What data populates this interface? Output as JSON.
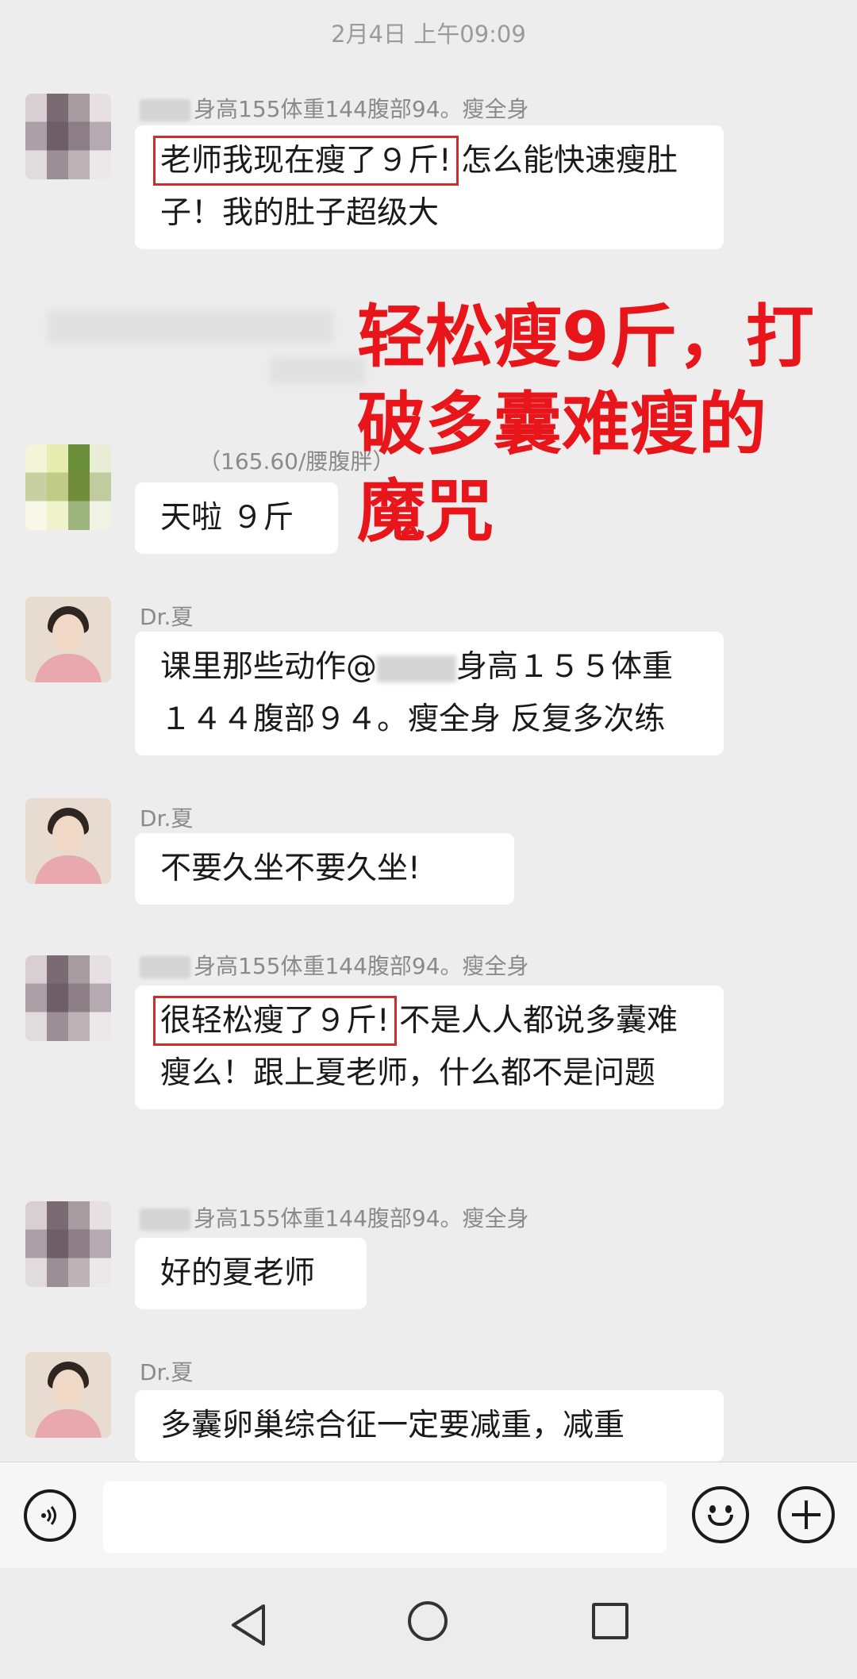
{
  "timestamp": "2月4日 上午09:09",
  "overlay_text": "轻松瘦9斤，打破多囊难瘦的魔咒",
  "messages": [
    {
      "sender": "身高155体重144腹部94。瘦全身",
      "highlight": "老师我现在瘦了９斤!",
      "text": "怎么能快速瘦肚子！我的肚子超级大"
    },
    {
      "sender": "（165.60/腰腹胖）",
      "text": "天啦 ９斤"
    },
    {
      "sender": "Dr.夏",
      "text_a": "课里那些动作@",
      "text_b": "身高１５５体重１４４腹部９４。瘦全身 反复多次练"
    },
    {
      "sender": "Dr.夏",
      "text": "不要久坐不要久坐!"
    },
    {
      "sender": "身高155体重144腹部94。瘦全身",
      "highlight": "很轻松瘦了９斤!",
      "text": "不是人人都说多囊难瘦么！跟上夏老师，什么都不是问题"
    },
    {
      "sender": "身高155体重144腹部94。瘦全身",
      "text": "好的夏老师"
    },
    {
      "sender": "Dr.夏",
      "text": "多囊卵巢综合征一定要减重，减重"
    }
  ],
  "input": {
    "placeholder": ""
  },
  "icons": {
    "voice": "voice-icon",
    "emoji": "emoji-icon",
    "plus": "plus-icon",
    "back": "back-icon",
    "home": "home-icon",
    "recent": "recent-apps-icon"
  }
}
